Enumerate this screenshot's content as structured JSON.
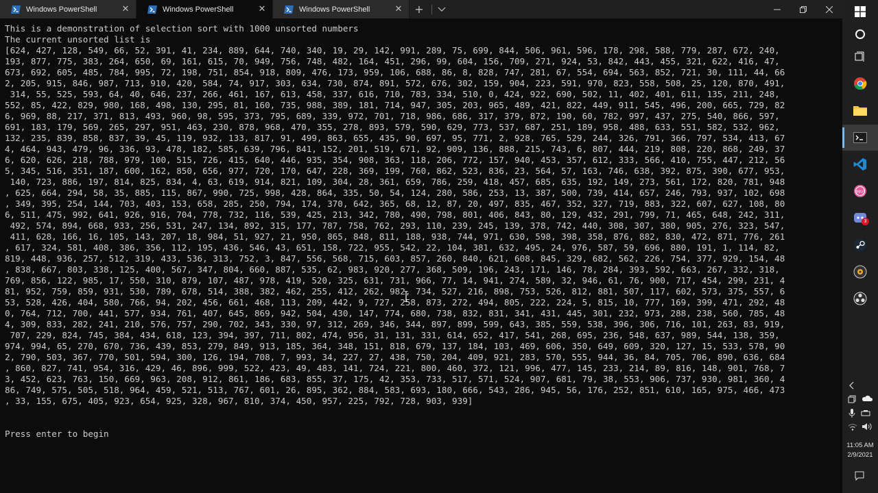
{
  "window": {
    "tabs": [
      {
        "label": "Windows PowerShell",
        "active": false
      },
      {
        "label": "Windows PowerShell",
        "active": true
      },
      {
        "label": "Windows PowerShell",
        "active": false
      }
    ],
    "new_tab_glyph": "+",
    "dropdown_glyph": "⌄",
    "controls": {
      "minimize": "—",
      "maximize": "❐",
      "close": "✕"
    }
  },
  "terminal": {
    "lines": [
      "This is a demonstration of selection sort with 1000 unsorted numbers",
      "The current unsorted list is",
      "[624, 427, 128, 549, 66, 52, 391, 41, 234, 889, 644, 740, 340, 19, 29, 142, 991, 289, 75, 699, 844, 506, 961, 596, 178, 298, 588, 779, 287, 672, 240,",
      "193, 877, 775, 383, 264, 650, 69, 161, 615, 70, 949, 756, 748, 482, 164, 451, 296, 99, 604, 156, 709, 271, 924, 53, 842, 443, 455, 321, 622, 416, 47,",
      "673, 692, 605, 485, 784, 995, 72, 198, 751, 854, 918, 809, 476, 173, 959, 106, 688, 86, 8, 828, 747, 281, 67, 554, 694, 563, 852, 721, 30, 111, 44, 66",
      "2, 205, 915, 846, 987, 713, 910, 420, 584, 74, 917, 303, 634, 730, 874, 891, 572, 676, 302, 159, 904, 223, 591, 970, 823, 558, 508, 25, 120, 870, 491,",
      " 314, 55, 525, 593, 64, 40, 646, 237, 266, 461, 167, 613, 458, 337, 616, 710, 783, 334, 510, 0, 424, 922, 690, 502, 11, 402, 401, 611, 135, 211, 248,",
      "552, 85, 422, 829, 980, 168, 498, 130, 295, 81, 160, 735, 988, 389, 181, 714, 947, 305, 203, 965, 489, 421, 822, 449, 911, 545, 496, 200, 665, 729, 82",
      "6, 969, 88, 217, 371, 813, 493, 960, 98, 595, 373, 795, 689, 339, 972, 701, 718, 986, 686, 317, 379, 872, 190, 60, 782, 997, 437, 275, 540, 866, 597,",
      "691, 183, 179, 569, 265, 297, 951, 463, 230, 878, 968, 470, 355, 278, 893, 579, 590, 629, 773, 537, 687, 251, 189, 958, 488, 633, 551, 582, 532, 962,",
      "132, 235, 839, 858, 837, 39, 45, 119, 932, 133, 817, 91, 499, 863, 655, 435, 90, 697, 95, 771, 2, 928, 765, 529, 244, 326, 791, 366, 797, 534, 413, 67",
      "4, 464, 943, 479, 96, 336, 93, 478, 182, 585, 639, 796, 841, 152, 201, 519, 671, 92, 909, 136, 888, 215, 743, 6, 807, 444, 219, 808, 220, 868, 249, 37",
      "6, 620, 626, 218, 788, 979, 100, 515, 726, 415, 640, 446, 935, 354, 908, 363, 118, 206, 772, 157, 940, 453, 357, 612, 333, 566, 410, 755, 447, 212, 56",
      "5, 345, 516, 351, 187, 600, 162, 850, 656, 977, 720, 170, 647, 228, 369, 199, 760, 862, 523, 836, 23, 564, 57, 163, 746, 638, 392, 875, 390, 677, 953,",
      " 140, 723, 886, 197, 814, 825, 834, 4, 63, 619, 914, 821, 109, 304, 28, 361, 659, 786, 259, 418, 457, 685, 635, 192, 149, 273, 561, 172, 820, 781, 948",
      ", 625, 664, 294, 58, 35, 885, 115, 867, 990, 725, 998, 428, 864, 335, 50, 54, 124, 280, 586, 253, 13, 387, 500, 739, 414, 657, 246, 793, 937, 102, 698",
      ", 349, 395, 254, 144, 703, 403, 153, 658, 285, 250, 794, 174, 370, 642, 365, 68, 12, 87, 20, 497, 835, 467, 352, 327, 719, 883, 322, 607, 627, 108, 80",
      "6, 511, 475, 992, 641, 926, 916, 704, 778, 732, 116, 539, 425, 213, 342, 780, 490, 798, 801, 406, 843, 80, 129, 432, 291, 799, 71, 465, 648, 242, 311,",
      " 492, 574, 894, 668, 933, 256, 531, 247, 134, 892, 315, 177, 787, 758, 762, 293, 110, 239, 245, 139, 378, 742, 440, 308, 307, 380, 905, 276, 323, 547,",
      " 411, 628, 166, 16, 105, 143, 207, 18, 984, 51, 927, 21, 950, 865, 848, 811, 188, 938, 744, 971, 630, 598, 398, 358, 876, 882, 830, 472, 871, 776, 261",
      ", 617, 324, 581, 408, 386, 356, 112, 195, 436, 546, 43, 651, 158, 722, 955, 542, 22, 104, 381, 632, 495, 24, 976, 587, 59, 696, 880, 191, 1, 114, 82,",
      "819, 448, 936, 257, 512, 319, 433, 536, 313, 752, 3, 847, 556, 568, 715, 603, 857, 260, 840, 621, 608, 845, 329, 682, 562, 226, 754, 377, 929, 154, 48",
      ", 838, 667, 803, 338, 125, 400, 567, 347, 804, 660, 887, 535, 62, 983, 920, 277, 368, 509, 196, 243, 171, 146, 78, 284, 393, 592, 663, 267, 332, 318,",
      "769, 856, 122, 985, 17, 550, 310, 879, 107, 487, 978, 419, 520, 325, 631, 731, 966, 77, 14, 941, 274, 589, 32, 946, 61, 76, 900, 717, 454, 299, 231, 4",
      "81, 952, 759, 859, 931, 530, 789, 678, 514, 388, 382, 462, 255, 412, 262, 982, 734, 527, 216, 898, 753, 526, 812, 881, 507, 117, 602, 573, 375, 557, 6",
      "53, 528, 426, 404, 580, 766, 94, 202, 456, 661, 468, 113, 209, 442, 9, 727, 258, 873, 272, 494, 805, 222, 224, 5, 815, 10, 777, 169, 399, 471, 292, 48",
      "0, 764, 712, 700, 441, 577, 934, 761, 407, 645, 869, 942, 504, 430, 147, 774, 680, 738, 832, 831, 341, 431, 445, 301, 232, 973, 288, 238, 560, 785, 48",
      "4, 309, 833, 282, 241, 210, 576, 757, 290, 702, 343, 330, 97, 312, 269, 346, 344, 897, 899, 599, 643, 385, 559, 538, 396, 306, 716, 101, 263, 83, 919,",
      " 707, 229, 824, 745, 384, 434, 618, 123, 394, 397, 711, 802, 474, 956, 31, 131, 331, 614, 652, 417, 541, 268, 695, 236, 548, 637, 989, 544, 138, 359,",
      "974, 994, 65, 270, 670, 736, 439, 853, 279, 849, 913, 185, 364, 348, 151, 818, 679, 137, 184, 103, 469, 606, 350, 649, 609, 320, 127, 15, 533, 578, 90",
      "2, 790, 503, 367, 770, 501, 594, 300, 126, 194, 708, 7, 993, 34, 227, 27, 438, 750, 204, 409, 921, 283, 570, 555, 944, 36, 84, 705, 706, 890, 636, 684",
      ", 860, 827, 741, 954, 316, 429, 46, 896, 999, 522, 423, 49, 483, 141, 724, 221, 800, 460, 372, 121, 996, 477, 145, 233, 214, 89, 816, 148, 901, 768, 7",
      "3, 452, 623, 763, 150, 669, 963, 208, 912, 861, 186, 683, 855, 37, 175, 42, 353, 733, 517, 571, 524, 907, 681, 79, 38, 553, 906, 737, 930, 981, 360, 4",
      "86, 749, 575, 505, 518, 964, 459, 521, 513, 767, 601, 26, 895, 362, 884, 583, 693, 180, 666, 543, 286, 945, 56, 176, 252, 851, 610, 165, 975, 466, 473",
      ", 33, 155, 675, 405, 923, 654, 925, 328, 967, 810, 374, 450, 957, 225, 792, 728, 903, 939]",
      "",
      "",
      "Press enter to begin"
    ]
  },
  "taskbar": {
    "clock_time": "11:05 AM",
    "clock_date": "2/9/2021",
    "badge_count": "3",
    "icons": [
      "windows-start-icon",
      "cortana-icon",
      "task-view-icon",
      "chrome-icon",
      "file-explorer-icon",
      "terminal-icon",
      "vscode-icon",
      "osu-icon",
      "discord-icon",
      "steam-icon",
      "media-player-icon",
      "obs-icon"
    ]
  },
  "colors": {
    "terminal_bg": "#0c0c0c",
    "terminal_fg": "#cccccc",
    "tabbar_bg": "#202020",
    "taskbar_bg": "#1f1f1f",
    "accent": "#76b9ed"
  }
}
